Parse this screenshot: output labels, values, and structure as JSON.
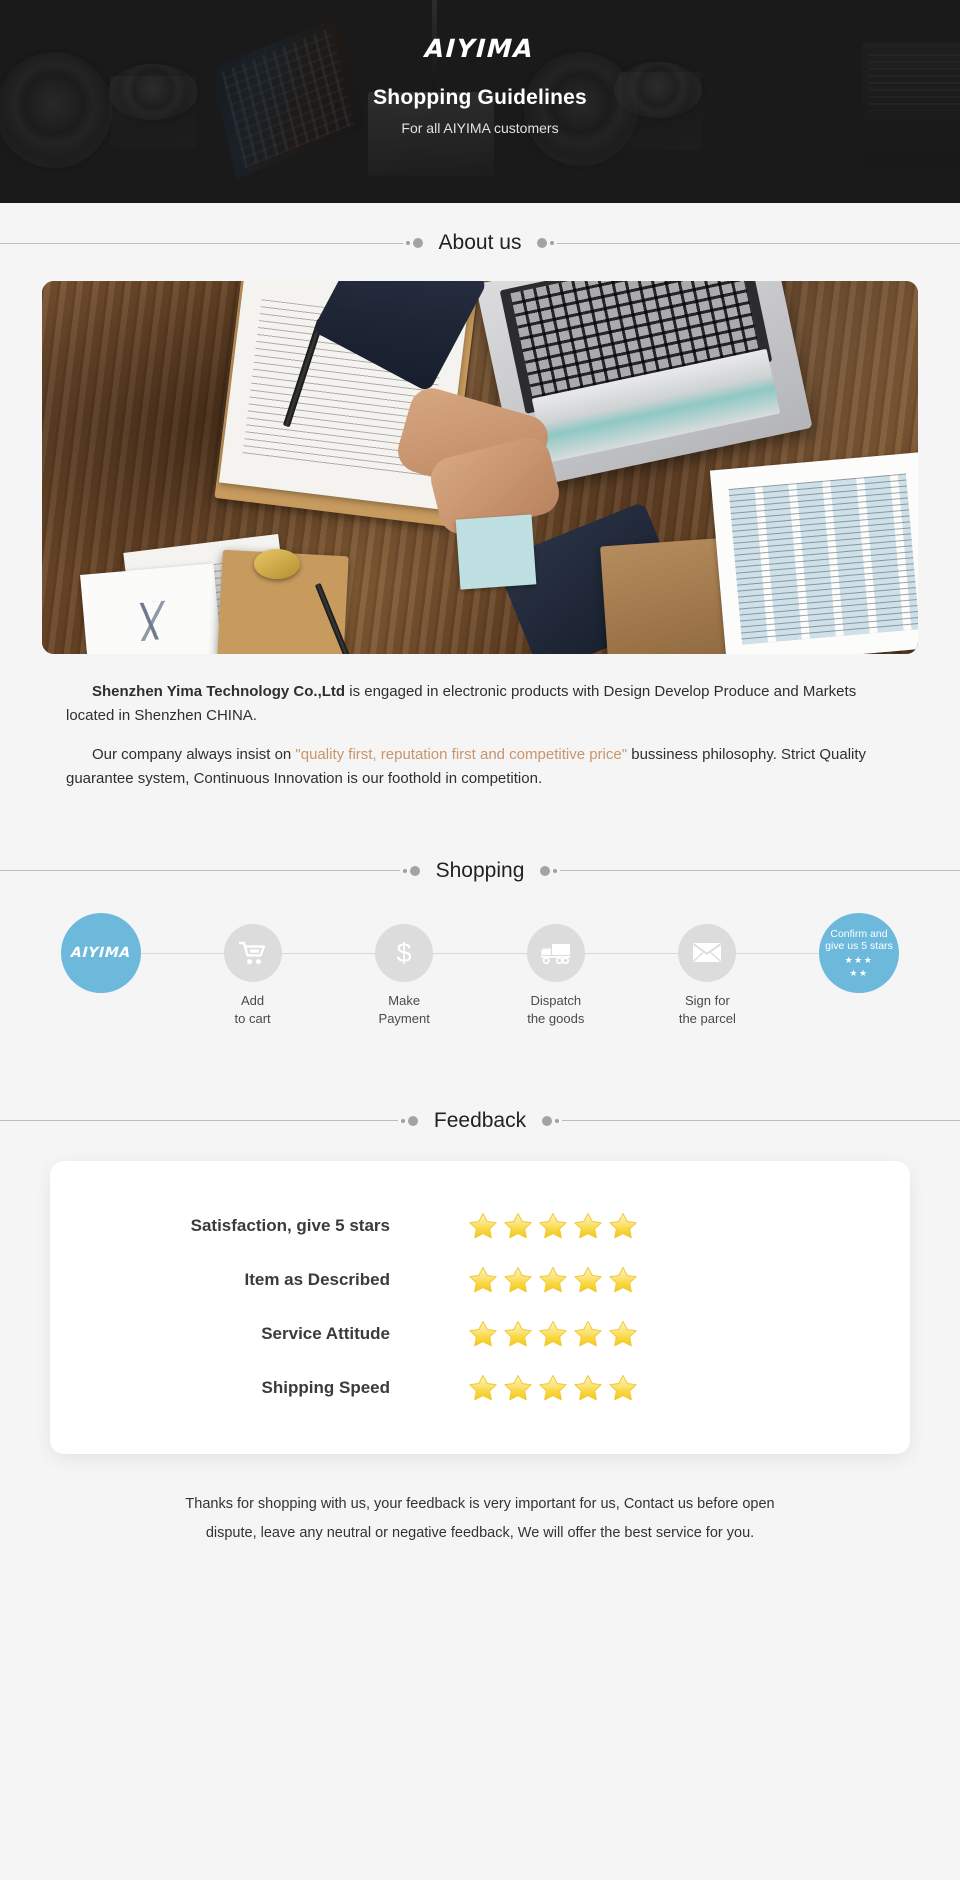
{
  "hero": {
    "brand": "AIYIMA",
    "title": "Shopping Guidelines",
    "subtitle": "For all AIYIMA customers",
    "background_color": "#1a1a1a"
  },
  "sections": {
    "about_heading": "About us",
    "shopping_heading": "Shopping",
    "feedback_heading": "Feedback"
  },
  "about": {
    "image_alt": "business-handshake-over-desk-photo",
    "paragraph1_company": "Shenzhen Yima Technology Co.,Ltd",
    "paragraph1_rest": " is engaged in electronic products with Design Develop Produce and Markets located in Shenzhen CHINA.",
    "paragraph2_pre": "Our company always insist on ",
    "paragraph2_quote": "\"quality first, reputation first and competitive price\"",
    "paragraph2_post": " bussiness philosophy. Strict Quality guarantee system, Continuous Innovation is our foothold in competition.",
    "quote_color": "#c9956b"
  },
  "shopping": {
    "accent_color": "#6cb9dc",
    "steps": [
      {
        "id": "brand",
        "icon": "aiyima-logo",
        "logo": "AIYIMA",
        "label": "",
        "style": "brand"
      },
      {
        "id": "add-to-cart",
        "icon": "cart-icon",
        "label": "Add\nto cart",
        "style": "normal"
      },
      {
        "id": "make-payment",
        "icon": "dollar-icon",
        "label": "Make\nPayment",
        "style": "normal"
      },
      {
        "id": "dispatch-goods",
        "icon": "truck-icon",
        "label": "Dispatch\nthe goods",
        "style": "normal"
      },
      {
        "id": "sign-parcel",
        "icon": "envelope-icon",
        "label": "Sign for\nthe parcel",
        "style": "normal"
      },
      {
        "id": "confirm-rate",
        "icon": "stars-icon",
        "label": "",
        "inner_text": "Confirm and\ngive us 5 stars",
        "stars_row1": "★★★",
        "stars_row2": "★★",
        "style": "confirm"
      }
    ]
  },
  "feedback": {
    "rows": [
      {
        "label": "Satisfaction, give 5 stars",
        "stars": 5
      },
      {
        "label": "Item as Described",
        "stars": 5
      },
      {
        "label": "Service Attitude",
        "stars": 5
      },
      {
        "label": "Shipping Speed",
        "stars": 5
      }
    ],
    "star_color_top": "#fdf0a8",
    "star_color_bottom": "#f8d22a"
  },
  "footer": {
    "line1": "Thanks for shopping with us, your feedback is very important for us, Contact us before open",
    "line2": "dispute, leave any neutral or negative feedback, We will offer the best service for you."
  }
}
